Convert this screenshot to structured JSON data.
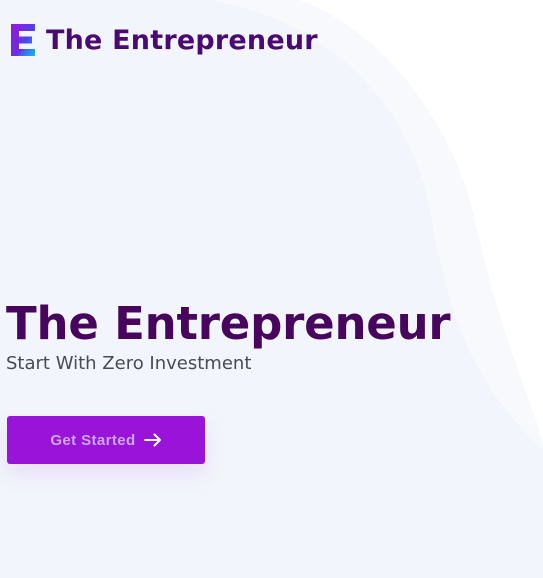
{
  "header": {
    "logo_icon": "e-letter-logo-icon",
    "brand_name": "The Entrepreneur"
  },
  "hero": {
    "title": "The Entrepreneur",
    "subtitle": "Start With Zero Investment",
    "cta_label": "Get Started",
    "cta_icon": "arrow-right-icon"
  },
  "colors": {
    "brand_text": "#4b0a73",
    "hero_title": "#48055e",
    "subtitle": "#4a4a52",
    "cta_background": "#9a13d9",
    "cta_text": "#caa8ea",
    "background_wave": "#f2f5fb",
    "background_wave_outer": "#f7f9fd"
  }
}
